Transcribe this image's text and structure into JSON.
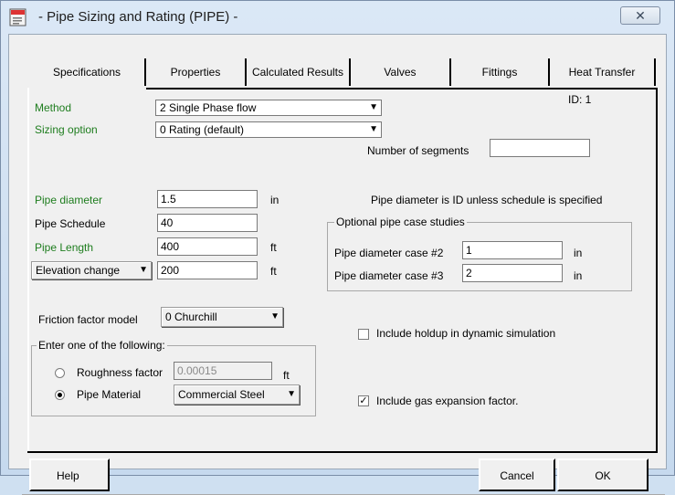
{
  "window": {
    "title": "- Pipe Sizing and Rating (PIPE) -",
    "close_glyph": "✕",
    "app_icon": "app-document-icon"
  },
  "tabs": [
    "Specifications",
    "Properties",
    "Calculated Results",
    "Valves",
    "Fittings",
    "Heat Transfer"
  ],
  "id_label": "ID:  1",
  "method": {
    "label": "Method",
    "value": "2 Single Phase flow"
  },
  "sizing_option": {
    "label": "Sizing option",
    "value": "0 Rating (default)"
  },
  "number_of_segments": {
    "label": "Number of segments",
    "value": ""
  },
  "pipe_diameter": {
    "label": "Pipe diameter",
    "value": "1.5",
    "unit": "in"
  },
  "diameter_note": "Pipe diameter is ID unless schedule is specified",
  "pipe_schedule": {
    "label": "Pipe Schedule",
    "value": "40"
  },
  "pipe_length": {
    "label": "Pipe Length",
    "value": "400",
    "unit": "ft"
  },
  "elevation_change": {
    "label": "Elevation change",
    "value": "200",
    "unit": "ft"
  },
  "case_studies": {
    "title": "Optional pipe case studies",
    "case2": {
      "label": "Pipe diameter case #2",
      "value": "1",
      "unit": "in"
    },
    "case3": {
      "label": "Pipe diameter case #3",
      "value": "2",
      "unit": "in"
    }
  },
  "friction_model": {
    "label": "Friction factor model",
    "value": "0 Churchill"
  },
  "roughness_group": {
    "title": "Enter one of the following:",
    "roughness": {
      "label": "Roughness factor",
      "value": "0.00015",
      "unit": "ft",
      "selected": false
    },
    "material": {
      "label": "Pipe Material",
      "value": "Commercial Steel",
      "selected": true
    }
  },
  "include_holdup": {
    "label": "Include holdup in dynamic simulation",
    "checked": false
  },
  "include_gas_expansion": {
    "label": "Include gas expansion factor.",
    "checked": true,
    "check_glyph": "✓"
  },
  "buttons": {
    "help": "Help",
    "cancel": "Cancel",
    "ok": "OK"
  },
  "arrow_glyph": "▼"
}
